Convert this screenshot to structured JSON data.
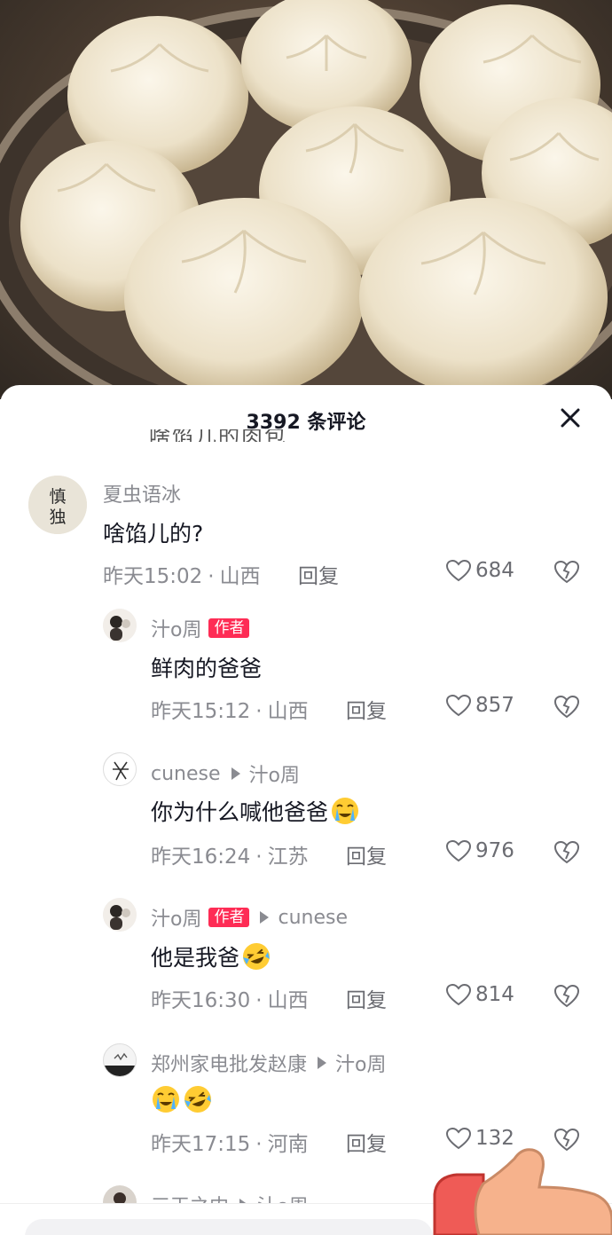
{
  "sheet": {
    "title": "3392 条评论",
    "partial_text": "啥馅儿的肉包"
  },
  "comments": [
    {
      "user": "夏虫语冰",
      "text": "啥馅儿的?",
      "time": "昨天15:02",
      "location": "山西",
      "reply": "回复",
      "likes": "684",
      "avatar_text": "慎独"
    },
    {
      "user": "汁o周",
      "badge": "作者",
      "text": "鲜肉的爸爸",
      "time": "昨天15:12",
      "location": "山西",
      "reply": "回复",
      "likes": "857"
    },
    {
      "user": "cunese",
      "reply_to": "汁o周",
      "text": "你为什么喊他爸爸",
      "time": "昨天16:24",
      "location": "江苏",
      "reply": "回复",
      "likes": "976"
    },
    {
      "user": "汁o周",
      "badge": "作者",
      "reply_to": "cunese",
      "text": "他是我爸",
      "time": "昨天16:30",
      "location": "山西",
      "reply": "回复",
      "likes": "814"
    },
    {
      "user": "郑州家电批发赵康",
      "reply_to": "汁o周",
      "text": "",
      "time": "昨天17:15",
      "location": "河南",
      "reply": "回复",
      "likes": "132"
    },
    {
      "user": "三天之内",
      "reply_to": "汁o周"
    }
  ],
  "colors": {
    "accent": "#fe2c55",
    "meta": "#8a8b91",
    "text": "#161823"
  },
  "icons": [
    "close-icon",
    "heart-icon",
    "broken-heart-icon",
    "reply-arrow-icon",
    "crying-emoji-icon",
    "laughing-emoji-icon",
    "thumb-icon"
  ]
}
